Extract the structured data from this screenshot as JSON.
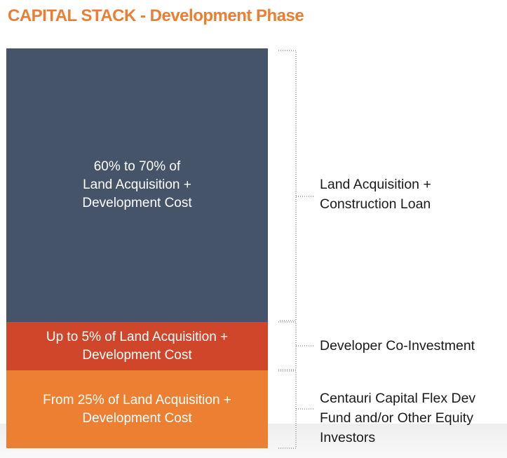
{
  "title": {
    "text": "CAPITAL STACK - Development Phase",
    "color": "#ED7D31"
  },
  "blocks": [
    {
      "name": "loan",
      "text": "60% to 70% of\nLand Acquisition +\nDevelopment Cost",
      "color": "#455468"
    },
    {
      "name": "developer",
      "text": "Up to 5% of Land Acquisition +\nDevelopment Cost",
      "color": "#D0462A"
    },
    {
      "name": "equity",
      "text": "From 25% of Land Acquisition +\nDevelopment Cost",
      "color": "#EC7F32"
    }
  ],
  "labels": [
    {
      "name": "loan",
      "text": "Land Acquisition +\nConstruction Loan"
    },
    {
      "name": "developer",
      "text": "Developer Co-Investment"
    },
    {
      "name": "equity",
      "text": "Centauri Capital Flex Dev\nFund and/or Other Equity\nInvestors"
    }
  ]
}
